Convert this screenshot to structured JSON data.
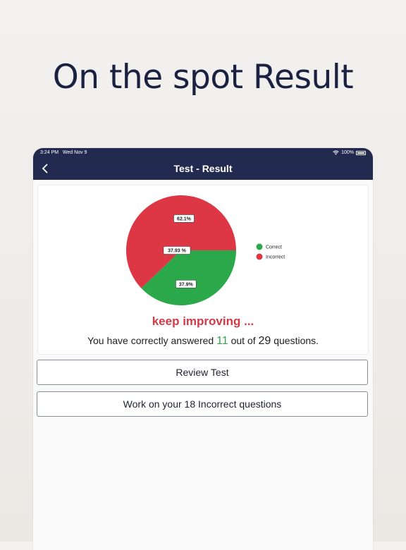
{
  "headline": "On the spot Result",
  "status": {
    "time": "3:24 PM",
    "date": "Wed Nov 9",
    "battery": "100%"
  },
  "nav": {
    "title": "Test - Result"
  },
  "chart_data": {
    "type": "pie",
    "slices": [
      {
        "label": "Incorrect",
        "value": 62.1,
        "display": "62.1%",
        "color": "#dd3645"
      },
      {
        "label": "Correct",
        "value": 37.9,
        "display": "37.9%",
        "color": "#2ba84a"
      }
    ],
    "center_label": "37.93 %",
    "legend": [
      {
        "label": "Correct",
        "color": "#2ba84a"
      },
      {
        "label": "Incorrect",
        "color": "#dd3645"
      }
    ],
    "legend_position": "right"
  },
  "result": {
    "message": "keep improving ...",
    "text_prefix": "You have correctly answered ",
    "correct": "11",
    "text_middle": " out of ",
    "total": "29",
    "text_suffix": " questions."
  },
  "buttons": {
    "review": "Review Test",
    "work": "Work on your 18 Incorrect questions"
  },
  "colors": {
    "navy": "#232a50",
    "correct": "#3ba14a",
    "incorrect": "#d23a48"
  }
}
